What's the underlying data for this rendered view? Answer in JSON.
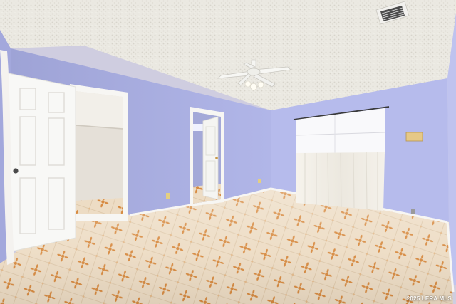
{
  "photo": {
    "watermark": "2025 LERA MLS"
  },
  "palette": {
    "wall": "#b4b9ea",
    "ceiling": "#eceae3",
    "floor": "#ecdcc6",
    "tile_motif": "#d6883e",
    "door": "#f6f6f4",
    "curtain": "#f1eee7"
  }
}
